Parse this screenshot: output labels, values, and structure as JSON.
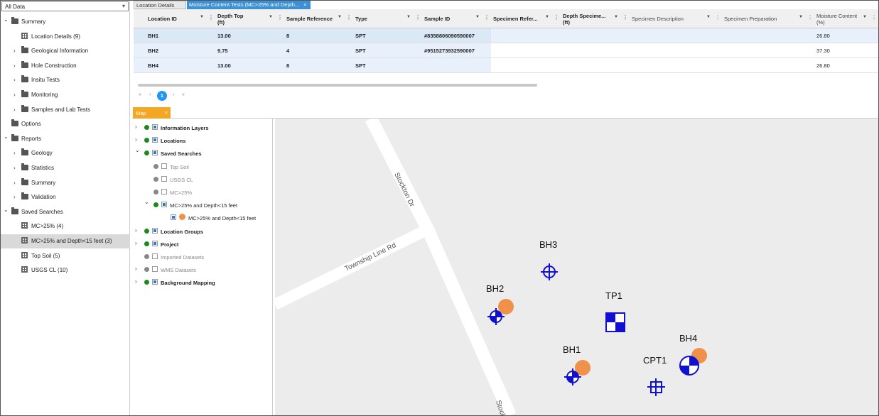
{
  "left_panel": {
    "dropdown_value": "All Data",
    "tree": [
      {
        "label": "Summary",
        "level": 0,
        "expanded": true,
        "kind": "folder"
      },
      {
        "label": "Location Details (9)",
        "level": 1,
        "kind": "grid"
      },
      {
        "label": "Geological Information",
        "level": 1,
        "expanded": false,
        "kind": "folder"
      },
      {
        "label": "Hole Construction",
        "level": 1,
        "expanded": false,
        "kind": "folder"
      },
      {
        "label": "Insitu Tests",
        "level": 1,
        "expanded": false,
        "kind": "folder"
      },
      {
        "label": "Monitoring",
        "level": 1,
        "expanded": false,
        "kind": "folder"
      },
      {
        "label": "Samples and Lab Tests",
        "level": 1,
        "expanded": false,
        "kind": "folder"
      },
      {
        "label": "Options",
        "level": 0,
        "kind": "folder-nochev"
      },
      {
        "label": "Reports",
        "level": 0,
        "expanded": true,
        "kind": "folder"
      },
      {
        "label": "Geology",
        "level": 1,
        "expanded": false,
        "kind": "folder"
      },
      {
        "label": "Statistics",
        "level": 1,
        "expanded": false,
        "kind": "folder"
      },
      {
        "label": "Summary",
        "level": 1,
        "expanded": false,
        "kind": "folder"
      },
      {
        "label": "Validation",
        "level": 1,
        "expanded": false,
        "kind": "folder"
      },
      {
        "label": "Saved Searches",
        "level": 0,
        "expanded": true,
        "kind": "folder"
      },
      {
        "label": "MC>25% (4)",
        "level": 1,
        "kind": "grid"
      },
      {
        "label": "MC>25% and Depth<15 feet (3)",
        "level": 1,
        "kind": "grid",
        "selected": true
      },
      {
        "label": "Top Soil (5)",
        "level": 1,
        "kind": "grid"
      },
      {
        "label": "USGS CL (10)",
        "level": 1,
        "kind": "grid"
      }
    ]
  },
  "tabs": [
    {
      "label": "Location Details",
      "active": false
    },
    {
      "label": "Moisture Content Tests (MC>25% and Depth...",
      "active": true
    }
  ],
  "table": {
    "columns": [
      {
        "line1": "Location ID",
        "line2": "",
        "bold": true
      },
      {
        "line1": "Depth Top",
        "line2": "(ft)",
        "bold": true
      },
      {
        "line1": "Sample Reference",
        "line2": "",
        "bold": true
      },
      {
        "line1": "Type",
        "line2": "",
        "bold": true
      },
      {
        "line1": "Sample ID",
        "line2": "",
        "bold": true
      },
      {
        "line1": "Specimen Refer...",
        "line2": "",
        "bold": true
      },
      {
        "line1": "Depth Specime...",
        "line2": "(ft)",
        "bold": true
      },
      {
        "line1": "Specimen Description",
        "line2": "",
        "bold": false
      },
      {
        "line1": "Specimen Preparation",
        "line2": "",
        "bold": false
      },
      {
        "line1": "Moisture Content",
        "line2": "(%)",
        "bold": false
      }
    ],
    "rows": [
      [
        "BH1",
        "13.00",
        "8",
        "SPT",
        "#8358806090590007",
        "",
        "",
        "",
        "",
        "26.80"
      ],
      [
        "BH2",
        "9.75",
        "4",
        "SPT",
        "#9515273932590007",
        "",
        "",
        "",
        "",
        "37.30"
      ],
      [
        "BH4",
        "13.00",
        "8",
        "SPT",
        "",
        "",
        "",
        "",
        "",
        "26.80"
      ]
    ]
  },
  "pager": {
    "first": "«",
    "prev": "‹",
    "current": "1",
    "next": "›",
    "last": "»"
  },
  "map_tab": {
    "label": "Map",
    "close": "×"
  },
  "layers": [
    {
      "label": "Information Layers",
      "chevron": "right",
      "indent": 0,
      "dot": "#1a8a1a",
      "checked": true,
      "bold": true
    },
    {
      "label": "Locations",
      "chevron": "right",
      "indent": 0,
      "dot": "#1a8a1a",
      "checked": true,
      "bold": true
    },
    {
      "label": "Saved Searches",
      "chevron": "down",
      "indent": 0,
      "dot": "#1a8a1a",
      "checked": true,
      "bold": true
    },
    {
      "label": "Top Soil",
      "chevron": "",
      "indent": 1,
      "dot": "#888888",
      "checked": false,
      "bold": false
    },
    {
      "label": "USGS CL",
      "chevron": "",
      "indent": 1,
      "dot": "#888888",
      "checked": false,
      "bold": false
    },
    {
      "label": "MC>25%",
      "chevron": "",
      "indent": 1,
      "dot": "#888888",
      "checked": false,
      "bold": false
    },
    {
      "label": "MC>25% and Depth<15 feet",
      "chevron": "down",
      "indent": 1,
      "dot": "#1a8a1a",
      "checked": true,
      "bold": false,
      "dark": true
    },
    {
      "label": "MC>25% and Depth<15 feet",
      "chevron": "",
      "indent": 2,
      "dot": "",
      "checked": true,
      "bold": false,
      "dark": true,
      "orange": true
    },
    {
      "label": "Location Groups",
      "chevron": "right",
      "indent": 0,
      "dot": "#1a8a1a",
      "checked": true,
      "bold": true
    },
    {
      "label": "Project",
      "chevron": "right",
      "indent": 0,
      "dot": "#1a8a1a",
      "checked": true,
      "bold": true
    },
    {
      "label": "Imported Datasets",
      "chevron": "",
      "indent": 0,
      "dot": "#888888",
      "checked": false,
      "bold": false
    },
    {
      "label": "WMS Datasets",
      "chevron": "right",
      "indent": 0,
      "dot": "#888888",
      "checked": false,
      "bold": false
    },
    {
      "label": "Background Mapping",
      "chevron": "right",
      "indent": 0,
      "dot": "#1a8a1a",
      "checked": true,
      "bold": true
    }
  ],
  "map": {
    "streets": [
      "Stockton Dr",
      "Township Line Rd",
      "Stockt"
    ],
    "points": [
      "BH3",
      "BH2",
      "TP1",
      "BH1",
      "BH4",
      "CPT1"
    ],
    "marker_color": "#1010d0",
    "highlight_color": "#f0914a"
  }
}
